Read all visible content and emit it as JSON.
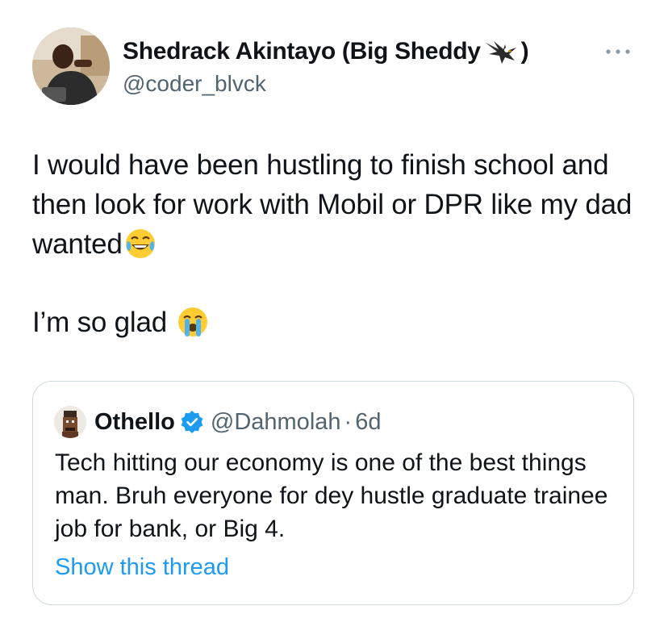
{
  "author": {
    "display_name": "Shedrack Akintayo (Big Sheddy",
    "name_emoji": "eagle-icon",
    "name_suffix": ")",
    "handle": "@coder_blvck",
    "avatar": "profile-photo"
  },
  "more_icon": "more-options-icon",
  "tweet": {
    "line1": "I would have been hustling to finish school and then look for work with Mobil or DPR like my dad wanted",
    "line1_emoji": "face-with-tears-of-joy-icon",
    "line2": "I’m so glad",
    "line2_emoji": "loudly-crying-face-icon"
  },
  "quote": {
    "display_name": "Othello",
    "verified_icon": "verified-badge-icon",
    "handle": "@Dahmolah",
    "separator": "·",
    "age": "6d",
    "text": "Tech hitting our economy is one of the best things man. Bruh everyone for dey hustle graduate trainee job for bank, or Big 4.",
    "link": "Show this thread"
  },
  "colors": {
    "text": "#0f1419",
    "secondary": "#536471",
    "link": "#1d9bf0",
    "border": "#cfd9de"
  }
}
